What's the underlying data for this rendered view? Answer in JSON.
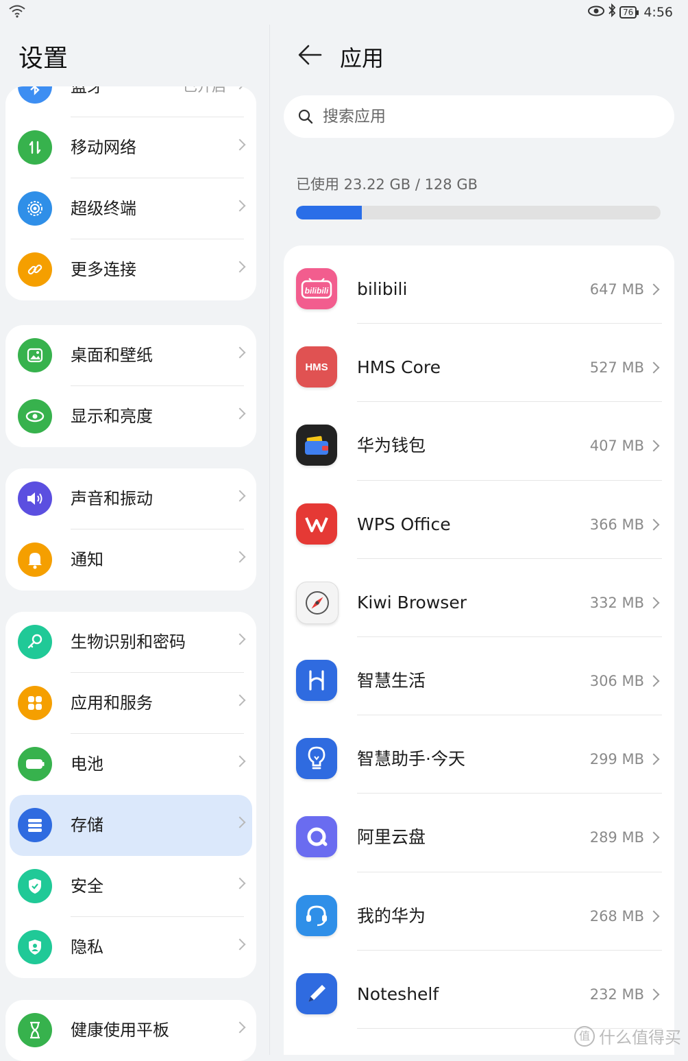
{
  "status_bar": {
    "battery": "76",
    "time": "4:56"
  },
  "left": {
    "title": "设置",
    "groups": [
      [
        {
          "label": "蓝牙",
          "value": "已开启",
          "icon": "bluetooth-icon",
          "color": "#3d8ef2"
        },
        {
          "label": "移动网络",
          "icon": "mobile-data-icon",
          "color": "#37b24d"
        },
        {
          "label": "超级终端",
          "icon": "super-device-icon",
          "color": "#2f8fe8"
        },
        {
          "label": "更多连接",
          "icon": "link-icon",
          "color": "#f59f00"
        }
      ],
      [
        {
          "label": "桌面和壁纸",
          "icon": "wallpaper-icon",
          "color": "#37b24d"
        },
        {
          "label": "显示和亮度",
          "icon": "eye-icon",
          "color": "#37b24d"
        }
      ],
      [
        {
          "label": "声音和振动",
          "icon": "speaker-icon",
          "color": "#5b4fe0"
        },
        {
          "label": "通知",
          "icon": "bell-icon",
          "color": "#f59f00"
        }
      ],
      [
        {
          "label": "生物识别和密码",
          "icon": "key-icon",
          "color": "#20c997"
        },
        {
          "label": "应用和服务",
          "icon": "apps-icon",
          "color": "#f59f00"
        },
        {
          "label": "电池",
          "icon": "battery-icon",
          "color": "#37b24d"
        },
        {
          "label": "存储",
          "icon": "storage-icon",
          "color": "#2f6be0",
          "selected": true
        },
        {
          "label": "安全",
          "icon": "shield-icon",
          "color": "#20c997"
        },
        {
          "label": "隐私",
          "icon": "privacy-icon",
          "color": "#20c997"
        }
      ],
      [
        {
          "label": "健康使用平板",
          "icon": "hourglass-icon",
          "color": "#37b24d"
        }
      ]
    ]
  },
  "right": {
    "title": "应用",
    "search_placeholder": "搜索应用",
    "storage_text": "已使用 23.22 GB / 128 GB",
    "storage_used_fraction": 0.181,
    "apps": [
      {
        "name": "bilibili",
        "size": "647 MB",
        "icon": "bilibili-icon",
        "color": "#f25d8e"
      },
      {
        "name": "HMS Core",
        "size": "527 MB",
        "icon": "hms-core-icon",
        "color": "#e05252"
      },
      {
        "name": "华为钱包",
        "size": "407 MB",
        "icon": "wallet-icon",
        "color": "#222222"
      },
      {
        "name": "WPS Office",
        "size": "366 MB",
        "icon": "wps-icon",
        "color": "#e53935"
      },
      {
        "name": "Kiwi Browser",
        "size": "332 MB",
        "icon": "compass-icon",
        "color": "#f4f4f4"
      },
      {
        "name": "智慧生活",
        "size": "306 MB",
        "icon": "smart-life-icon",
        "color": "#2f6be0"
      },
      {
        "name": "智慧助手·今天",
        "size": "299 MB",
        "icon": "lightbulb-icon",
        "color": "#2f6be0"
      },
      {
        "name": "阿里云盘",
        "size": "289 MB",
        "icon": "aliyun-drive-icon",
        "color": "#6a6cf0"
      },
      {
        "name": "我的华为",
        "size": "268 MB",
        "icon": "headset-icon",
        "color": "#2f8fe8"
      },
      {
        "name": "Noteshelf",
        "size": "232 MB",
        "icon": "pen-icon",
        "color": "#2f6be0"
      }
    ]
  },
  "watermark": {
    "glyph": "值",
    "text": "什么值得买"
  }
}
